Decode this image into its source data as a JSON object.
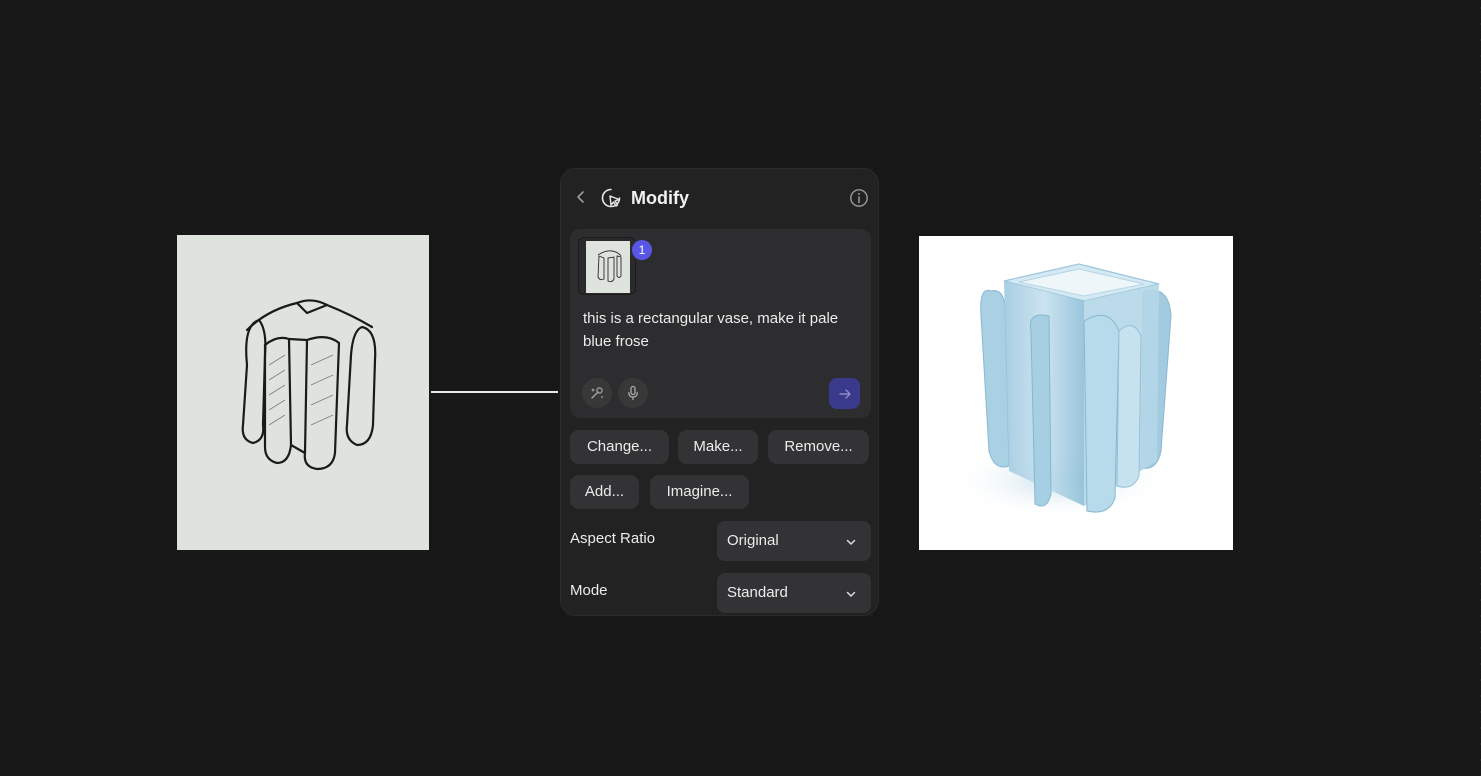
{
  "panel": {
    "title": "Modify",
    "prompt": {
      "attachment_count": "1",
      "text": "this is a rectangular vase, make it pale blue frose"
    },
    "suggestions": [
      "Change...",
      "Make...",
      "Remove...",
      "Add...",
      "Imagine..."
    ],
    "settings": {
      "aspect_ratio": {
        "label": "Aspect Ratio",
        "value": "Original"
      },
      "mode": {
        "label": "Mode",
        "value": "Standard"
      }
    }
  },
  "icons": {
    "back": "chevron-left-icon",
    "modify": "modify-cursor-icon",
    "info": "info-icon",
    "magic": "magic-wand-icon",
    "mic": "microphone-icon",
    "send": "arrow-right-icon",
    "dropdown": "chevron-down-icon"
  },
  "colors": {
    "canvas_background": "#171717",
    "panel_background": "#222222",
    "accent": "#5b57e6",
    "send_button": "#3a3a8c"
  }
}
